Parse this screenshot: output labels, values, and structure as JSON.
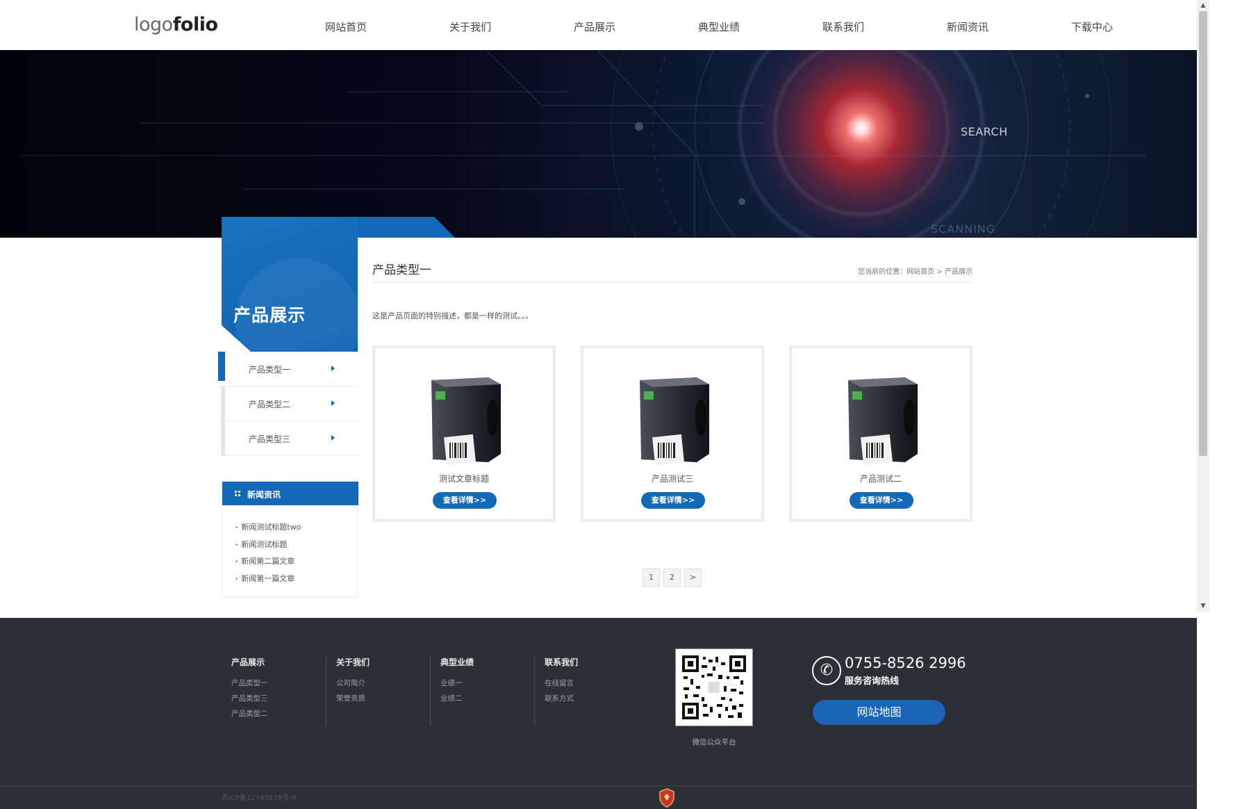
{
  "header": {
    "logo_part1": "logo",
    "logo_part2": "folio",
    "nav": [
      "网站首页",
      "关于我们",
      "产品展示",
      "典型业绩",
      "联系我们",
      "新闻资讯",
      "下载中心"
    ]
  },
  "banner": {
    "search_text": "SEARCH",
    "scanning_text": "SCANNING"
  },
  "sidebar": {
    "title": "产品展示",
    "categories": [
      {
        "label": "产品类型一",
        "active": true
      },
      {
        "label": "产品类型二",
        "active": false
      },
      {
        "label": "产品类型三",
        "active": false
      }
    ],
    "news_title": "新闻资讯",
    "news": [
      "新闻测试标题two",
      "新闻测试标题",
      "新闻第二篇文章",
      "新闻第一篇文章"
    ]
  },
  "main": {
    "title": "产品类型一",
    "breadcrumb": "您当前的位置：网站首页 > 产品展示",
    "description": "这是产品页面的特别描述，都是一样的测试。。。",
    "products": [
      {
        "title": "测试文章标题",
        "button": "查看详情>>"
      },
      {
        "title": "产品测试三",
        "button": "查看详情>>"
      },
      {
        "title": "产品测试二",
        "button": "查看详情>>"
      }
    ],
    "pager": [
      "1",
      "2",
      ">"
    ]
  },
  "footer": {
    "columns": [
      {
        "title": "产品展示",
        "links": [
          "产品类型一",
          "产品类型三",
          "产品类型二"
        ]
      },
      {
        "title": "关于我们",
        "links": [
          "公司简介",
          "荣誉资质"
        ]
      },
      {
        "title": "典型业绩",
        "links": [
          "业绩一",
          "业绩二"
        ]
      },
      {
        "title": "联系我们",
        "links": [
          "在线留言",
          "联系方式"
        ]
      }
    ],
    "qr_caption": "微信公众平台",
    "phone": "0755-8526 2996",
    "phone_sub": "服务咨询热线",
    "sitemap_button": "网站地图",
    "icp": "苏ICP备12345678号-9"
  },
  "colors": {
    "brand_blue": "#1468b8",
    "footer_bg": "#2c2f36"
  },
  "icons": {
    "phone": "phone-icon",
    "shield": "shield-icon",
    "arrow": "triangle-right-icon",
    "grid": "grid-icon"
  }
}
